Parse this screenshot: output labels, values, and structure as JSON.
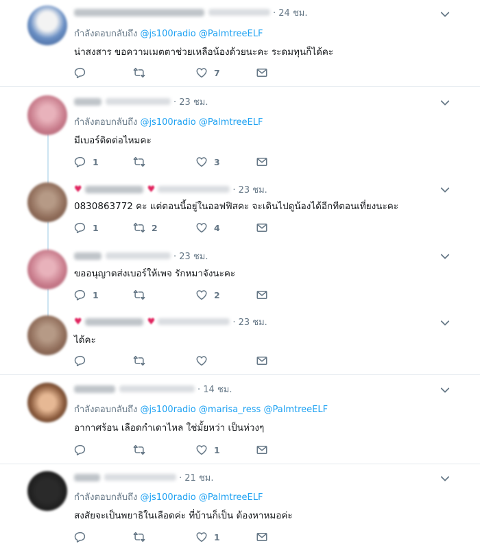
{
  "colors": {
    "link": "#1da1f2",
    "muted": "#657786",
    "text": "#14171a",
    "divider": "#e1e8ed",
    "thread": "#cde4f2"
  },
  "replying_prefix": "กำลังตอบกลับถึง",
  "tweets": [
    {
      "time": "· 24 ชม.",
      "replying_to": [
        "@js100radio",
        "@PalmtreeELF"
      ],
      "text": "น่าสงสาร ขอความเมตตาช่วยเหลือน้องด้วยนะคะ ระดมทุนก็ได้คะ",
      "counts": {
        "reply": "",
        "retweet": "",
        "like": "7"
      },
      "avatar": "blue-white-avatar"
    },
    {
      "time": "· 23 ชม.",
      "replying_to": [
        "@js100radio",
        "@PalmtreeELF"
      ],
      "text": "มีเบอร์ติดต่อไหมคะ",
      "counts": {
        "reply": "1",
        "retweet": "",
        "like": "3"
      },
      "avatar": "pink-avatar"
    },
    {
      "time": "· 23 ชม.",
      "replying_to": [],
      "text": "0830863772 คะ แต่ตอนนี้อยู่ในออฟฟิสคะ จะเดินไปดูน้องได้อีกทีตอนเที่ยงนะคะ",
      "counts": {
        "reply": "1",
        "retweet": "2",
        "like": "4"
      },
      "avatar": "brown-avatar"
    },
    {
      "time": "· 23 ชม.",
      "replying_to": [],
      "text": "ขออนุญาตส่งเบอร์ให้เพจ รักหมาจังนะคะ",
      "counts": {
        "reply": "1",
        "retweet": "",
        "like": "2"
      },
      "avatar": "pink-avatar"
    },
    {
      "time": "· 23 ชม.",
      "replying_to": [],
      "text": "ได้คะ",
      "counts": {
        "reply": "",
        "retweet": "",
        "like": ""
      },
      "avatar": "brown-avatar"
    },
    {
      "time": "· 14 ชม.",
      "replying_to": [
        "@js100radio",
        "@marisa_ress",
        "@PalmtreeELF"
      ],
      "text": "อากาศร้อน เลือดกำเดาไหล ใช่มั้ยหว่า เป็นห่วงๆ",
      "counts": {
        "reply": "",
        "retweet": "",
        "like": "1"
      },
      "avatar": "face-avatar"
    },
    {
      "time": "· 21 ชม.",
      "replying_to": [
        "@js100radio",
        "@PalmtreeELF"
      ],
      "text": "สงสัยจะเป็นพยาธิในเลือดค่ะ ที่บ้านก็เป็น ต้องหาหมอค่ะ",
      "counts": {
        "reply": "",
        "retweet": "",
        "like": "1"
      },
      "avatar": "dark-avatar"
    }
  ]
}
